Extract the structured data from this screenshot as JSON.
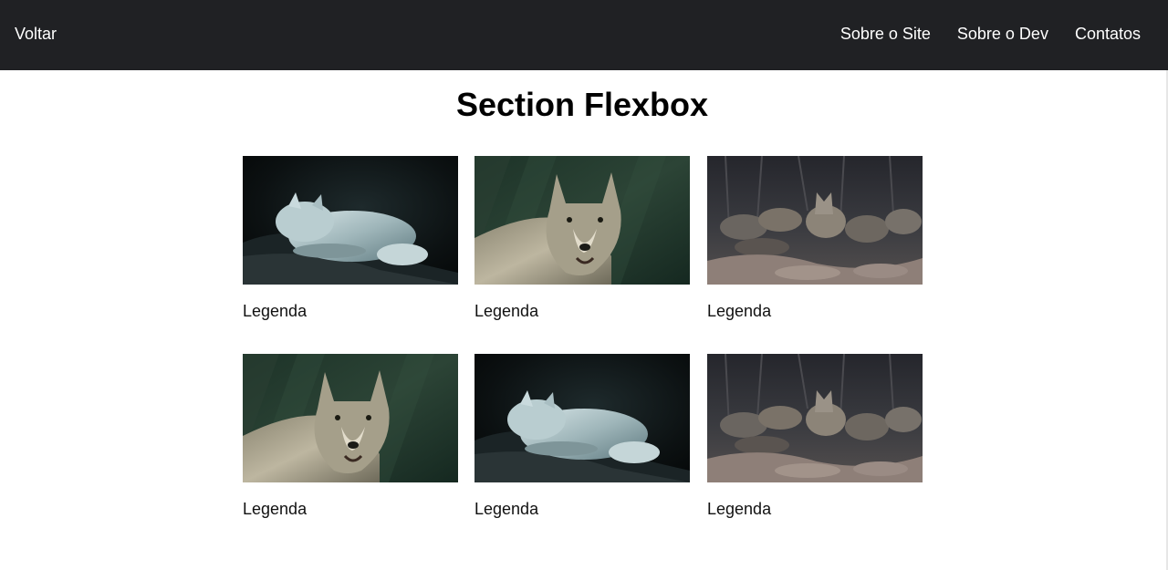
{
  "nav": {
    "back_label": "Voltar",
    "links": [
      "Sobre o Site",
      "Sobre o Dev",
      "Contatos"
    ]
  },
  "main": {
    "title": "Section Flexbox"
  },
  "gallery": {
    "items": [
      {
        "caption": "Legenda",
        "image": "white-wolf-resting-image"
      },
      {
        "caption": "Legenda",
        "image": "gray-wolf-portrait-image"
      },
      {
        "caption": "Legenda",
        "image": "wolf-pack-image"
      },
      {
        "caption": "Legenda",
        "image": "gray-wolf-portrait-image"
      },
      {
        "caption": "Legenda",
        "image": "white-wolf-resting-image"
      },
      {
        "caption": "Legenda",
        "image": "wolf-pack-image"
      }
    ]
  },
  "colors": {
    "navbar_background": "#202124",
    "navbar_text": "#ffffff",
    "page_background": "#ffffff"
  }
}
